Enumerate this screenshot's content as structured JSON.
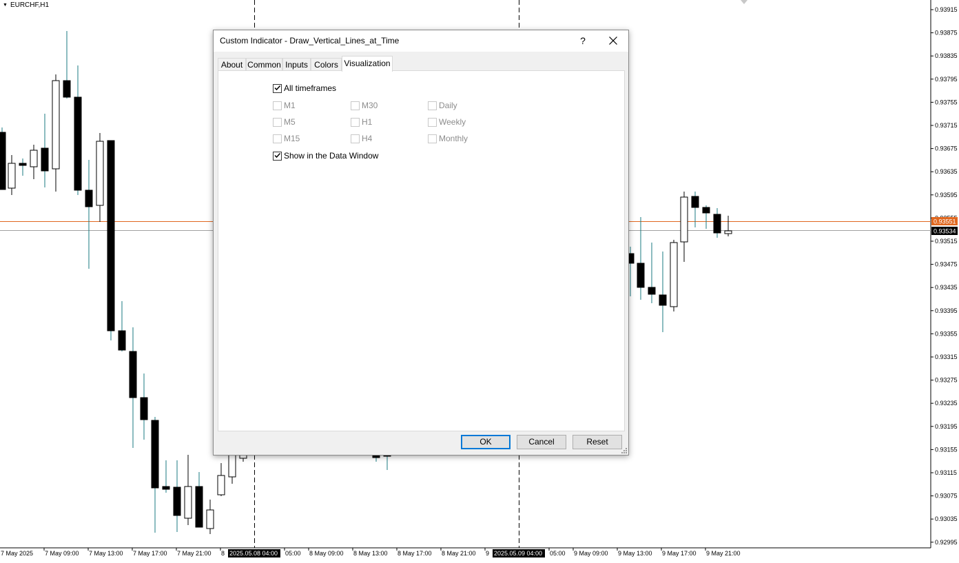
{
  "chart": {
    "symbol": "EURCHF,H1",
    "price_axis_labels": [
      "0.93915",
      "0.93875",
      "0.93835",
      "0.93795",
      "0.93755",
      "0.93715",
      "0.93675",
      "0.93635",
      "0.93595",
      "0.93555",
      "0.93515",
      "0.93475",
      "0.93435",
      "0.93395",
      "0.93355",
      "0.93315",
      "0.93275",
      "0.93235",
      "0.93195",
      "0.93155",
      "0.93115",
      "0.93075",
      "0.93035",
      "0.92995"
    ],
    "bid_price_tag": "0.93551",
    "ask_price_tag": "0.93534",
    "time_axis_labels": [
      "7 May 2025",
      "7 May 09:00",
      "7 May 13:00",
      "7 May 17:00",
      "7 May 21:00",
      "8",
      "05:00",
      "8 May 09:00",
      "8 May 13:00",
      "8 May 17:00",
      "8 May 21:00",
      "9",
      "05:00",
      "9 May 09:00",
      "9 May 13:00",
      "9 May 17:00",
      "9 May 21:00"
    ],
    "vline_tags": [
      "2025.05.08 04:00",
      "2025.05.09 04:00"
    ],
    "colors": {
      "bid_line": "#e0671e",
      "ask_line": "#a0a0a0",
      "bear_body": "#000000",
      "candle_wick": "#1a7a80"
    }
  },
  "dialog": {
    "title": "Custom Indicator - Draw_Vertical_Lines_at_Time",
    "help_icon": "?",
    "tabs": [
      {
        "label": "About",
        "active": false
      },
      {
        "label": "Common",
        "active": false
      },
      {
        "label": "Inputs",
        "active": false
      },
      {
        "label": "Colors",
        "active": false
      },
      {
        "label": "Visualization",
        "active": true
      }
    ],
    "visualization": {
      "all_timeframes": {
        "label": "All timeframes",
        "checked": true
      },
      "timeframes": [
        {
          "label": "M1",
          "checked": false,
          "enabled": false
        },
        {
          "label": "M30",
          "checked": false,
          "enabled": false
        },
        {
          "label": "Daily",
          "checked": false,
          "enabled": false
        },
        {
          "label": "M5",
          "checked": false,
          "enabled": false
        },
        {
          "label": "H1",
          "checked": false,
          "enabled": false
        },
        {
          "label": "Weekly",
          "checked": false,
          "enabled": false
        },
        {
          "label": "M15",
          "checked": false,
          "enabled": false
        },
        {
          "label": "H4",
          "checked": false,
          "enabled": false
        },
        {
          "label": "Monthly",
          "checked": false,
          "enabled": false
        }
      ],
      "show_in_data_window": {
        "label": "Show in the Data Window",
        "checked": true
      }
    },
    "buttons": {
      "ok": "OK",
      "cancel": "Cancel",
      "reset": "Reset"
    }
  }
}
